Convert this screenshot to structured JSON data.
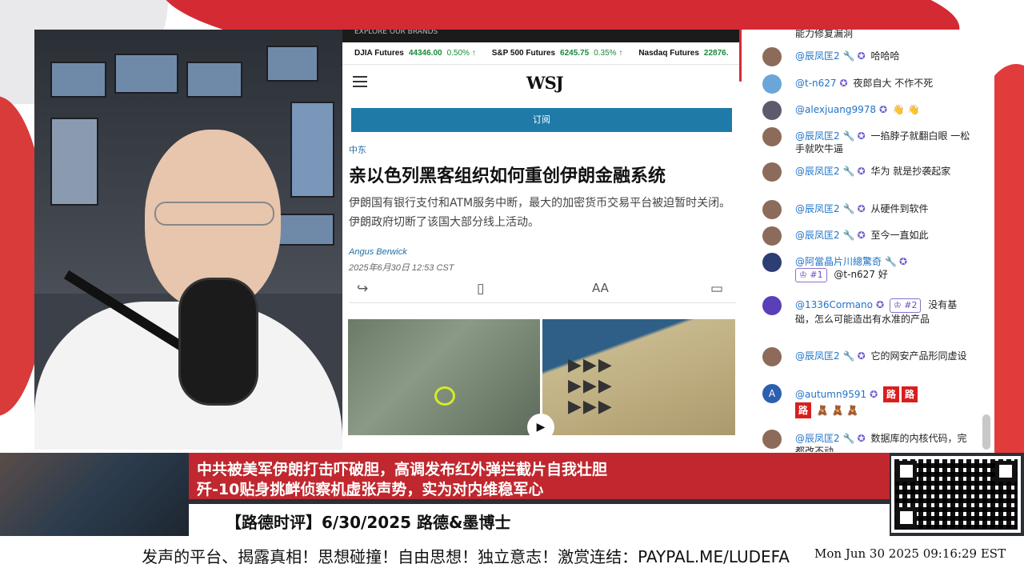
{
  "article": {
    "brands_label": "EXPLORE OUR BRANDS",
    "tickers": [
      {
        "name": "DJIA Futures",
        "value": "44346.00",
        "change": "0.50%"
      },
      {
        "name": "S&P 500 Futures",
        "value": "6245.75",
        "change": "0.35%"
      },
      {
        "name": "Nasdaq Futures",
        "value": "22876.",
        "change": ""
      }
    ],
    "logo": "WSJ",
    "subscribe_label": "订阅",
    "section": "中东",
    "headline": "亲以色列黑客组织如何重创伊朗金融系统",
    "dek": "伊朗国有银行支付和ATM服务中断，最大的加密货币交易平台被迫暂时关闭。伊朗政府切断了该国大部分线上活动。",
    "author": "Angus Berwick",
    "date": "2025年6月30日 12:53 CST",
    "text_size_icon": "AA"
  },
  "chat": {
    "messages": [
      {
        "user": "",
        "text": "能力修复漏洞"
      },
      {
        "user": "@辰凤匡2",
        "text": "哈哈哈"
      },
      {
        "user": "@t-n627",
        "text": "夜郎自大 不作不死"
      },
      {
        "user": "@alexjuang9978",
        "text": "👋 👋"
      },
      {
        "user": "@辰凤匡2",
        "text": "一掐脖子就翻白眼 一松手就吹牛逼"
      },
      {
        "user": "@辰凤匡2",
        "text": "华为 就是抄袭起家"
      },
      {
        "user": "@辰凤匡2",
        "text": "从硬件到软件"
      },
      {
        "user": "@辰凤匡2",
        "text": "至今一直如此"
      },
      {
        "user": "@阿當晶片川總驚奇",
        "rank": "#1",
        "text": "@t-n627 好"
      },
      {
        "user": "@1336Cormano",
        "rank": "#2",
        "text": "没有基础，怎么可能造出有水准的产品"
      },
      {
        "user": "@辰凤匡2",
        "text": "它的网安产品形同虚设"
      },
      {
        "user": "@autumn9591",
        "avatar_letter": "A",
        "road": "路",
        "text": "🧸 🧸 🧸"
      },
      {
        "user": "@辰凤匡2",
        "text": "数据库的内核代码，完都改不动"
      }
    ]
  },
  "banner": {
    "line1": "中共被美军伊朗打击吓破胆，高调发布红外弹拦截片自我壮胆",
    "line2": "歼-10贴身挑衅侦察机虚张声势，实为对内维稳军心",
    "program": "【路德时评】6/30/2025 路德&墨博士"
  },
  "footer": {
    "marquee": "发声的平台、揭露真相！思想碰撞！自由思想！独立意志！激赏连结：PAYPAL.ME/LUDEFA",
    "clock": "Mon Jun 30 2025 09:16:29 EST"
  },
  "colors": {
    "accent_red": "#c0272e",
    "wsj_blue": "#1f7aa8",
    "chat_user_blue": "#1f73c8",
    "ticker_green": "#1a8a3a"
  }
}
